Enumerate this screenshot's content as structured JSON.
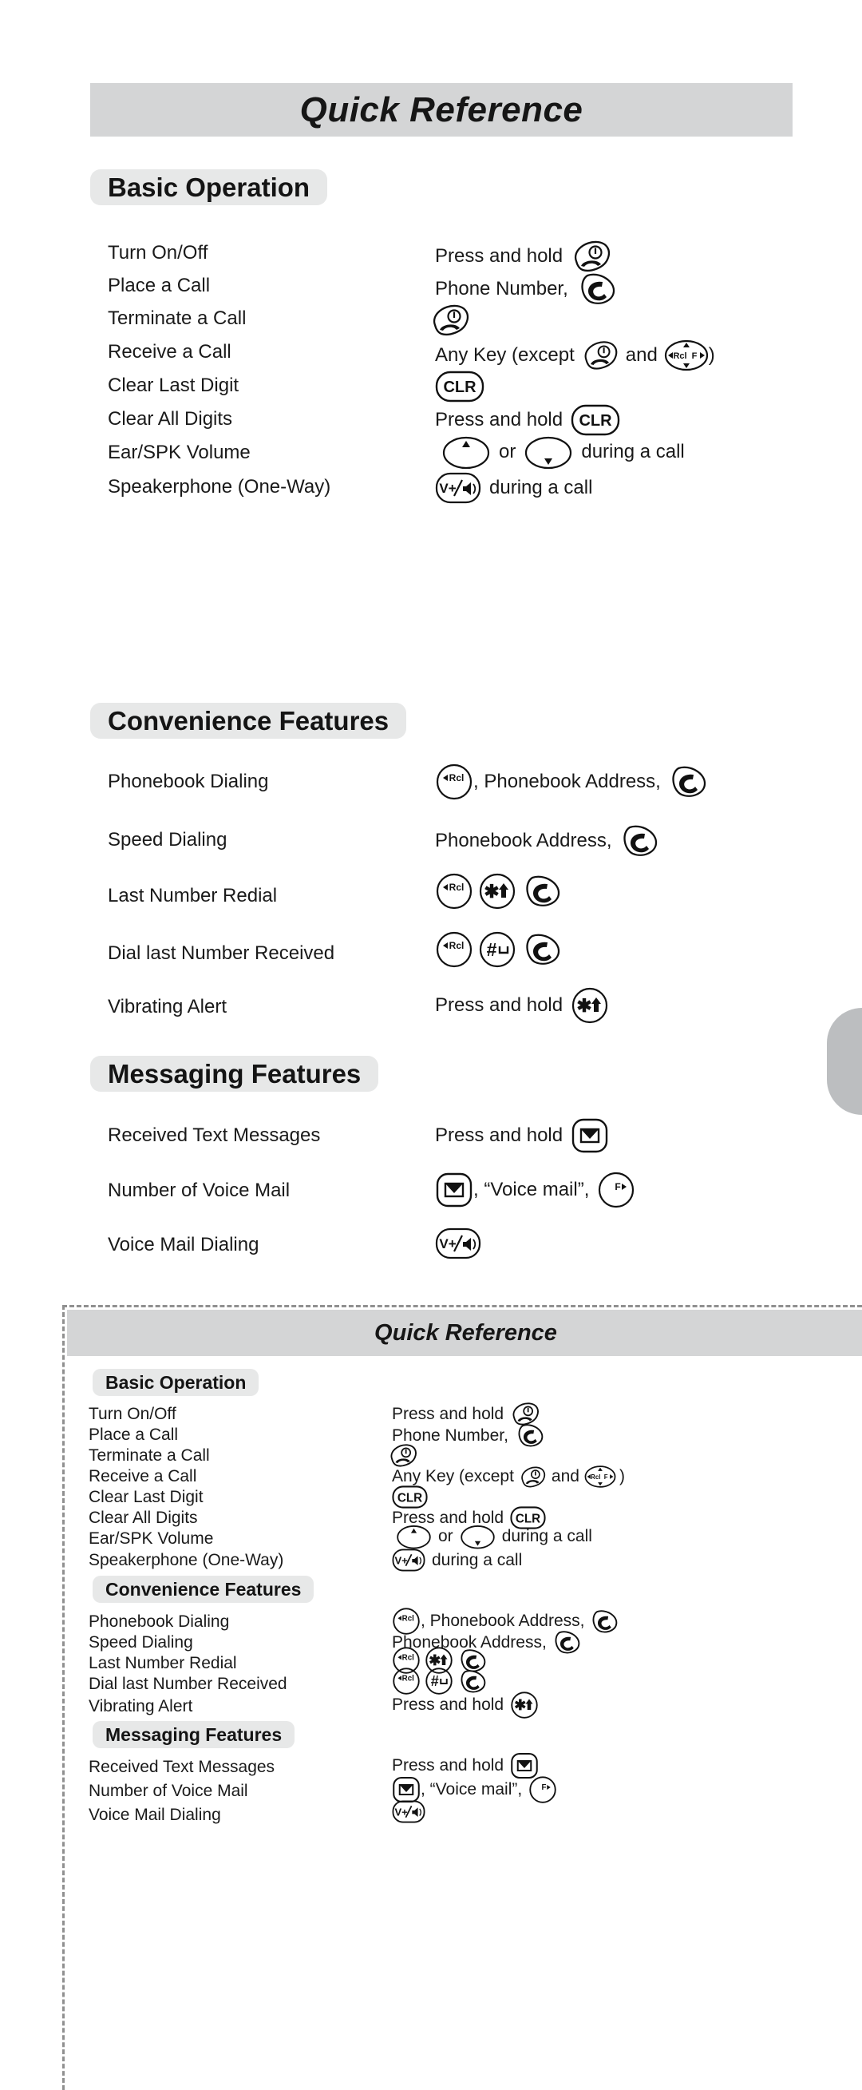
{
  "document": {
    "title": "Quick Reference"
  },
  "top_card": {
    "title": "Quick Reference",
    "sections": [
      {
        "heading": "Basic Operation",
        "rows": [
          {
            "label": "Turn On/Off",
            "value_text": "Press and hold",
            "keys": [
              "end-key"
            ]
          },
          {
            "label": "Place a Call",
            "value_text": "Phone Number,",
            "keys": [
              "send-key"
            ]
          },
          {
            "label": "Terminate a Call",
            "value_text": "",
            "keys": [
              "end-key"
            ]
          },
          {
            "label": "Receive a Call",
            "value_text": "Any Key (except",
            "keys": [
              "end-key",
              "nav-key"
            ]
          },
          {
            "label": "Clear Last Digit",
            "value_text": "",
            "keys": [
              "clr-key"
            ]
          },
          {
            "label": "Clear All Digits",
            "value_text": "Press and hold",
            "keys": [
              "clr-key"
            ]
          },
          {
            "label": "Ear/SPK Volume",
            "value_text": "",
            "keys": [
              "vol-up-key",
              "vol-down-key"
            ]
          },
          {
            "label": "Speakerphone (One-Way)",
            "value_text": "",
            "keys": [
              "spk-key"
            ]
          }
        ]
      },
      {
        "heading": "Convenience Features",
        "rows": [
          {
            "label": "Phonebook Dialing",
            "value_text": "",
            "keys": [
              "rcl-key",
              "send-key"
            ]
          },
          {
            "label": "Speed Dialing",
            "value_text": "Phonebook Address,",
            "keys": [
              "send-key"
            ]
          },
          {
            "label": "Last Number Redial",
            "value_text": "",
            "keys": [
              "rcl-key",
              "star-key",
              "send-key"
            ]
          },
          {
            "label": "Dial last Number Received",
            "value_text": "",
            "keys": [
              "rcl-key",
              "pound-key",
              "send-key"
            ]
          },
          {
            "label": "Vibrating Alert",
            "value_text": "Press and hold",
            "keys": [
              "star-key"
            ]
          }
        ]
      },
      {
        "heading": "Messaging Features",
        "rows": [
          {
            "label": "Received Text Messages",
            "value_text": "Press and hold",
            "keys": [
              "message-key"
            ]
          },
          {
            "label": "Number of Voice Mail",
            "value_text": "",
            "keys": [
              "message-key",
              "f-key"
            ]
          },
          {
            "label": "Voice Mail Dialing",
            "value_text": "",
            "keys": [
              "spk-key"
            ]
          }
        ]
      }
    ]
  },
  "bottom_card": {
    "title": "Quick Reference",
    "sections": [
      {
        "heading": "Basic Operation",
        "rows": [
          {
            "label": "Turn On/Off",
            "value_text": "Press and hold"
          },
          {
            "label": "Place a Call",
            "value_text": "Phone Number,"
          },
          {
            "label": "Terminate a Call",
            "value_text": ""
          },
          {
            "label": "Receive a Call",
            "value_text": "Any Key (except"
          },
          {
            "label": "Clear Last Digit",
            "value_text": ""
          },
          {
            "label": "Clear All Digits",
            "value_text": "Press and hold"
          },
          {
            "label": "Ear/SPK Volume",
            "value_text": ""
          },
          {
            "label": "Speakerphone (One-Way)",
            "value_text": ""
          }
        ]
      },
      {
        "heading": "Convenience Features",
        "rows": [
          {
            "label": "Phonebook Dialing",
            "value_text": ""
          },
          {
            "label": "Speed Dialing",
            "value_text": "Phonebook Address,"
          },
          {
            "label": "Last Number Redial",
            "value_text": ""
          },
          {
            "label": "Dial last Number Received",
            "value_text": ""
          },
          {
            "label": "Vibrating Alert",
            "value_text": "Press and hold"
          }
        ]
      },
      {
        "heading": "Messaging Features",
        "rows": [
          {
            "label": "Received Text Messages",
            "value_text": "Press and hold"
          },
          {
            "label": "Number of Voice Mail",
            "value_text": ""
          },
          {
            "label": "Voice Mail Dialing",
            "value_text": ""
          }
        ]
      }
    ]
  },
  "phrases": {
    "and": "and",
    "close_paren": ")",
    "comma": ",",
    "comma_phonebook_address": ", Phonebook Address,",
    "or": "or",
    "during_a_call": "during a call",
    "voice_mail_quoted": ", “Voice mail”,"
  },
  "key_labels": {
    "clr": "CLR",
    "rcl": "Rcl",
    "f": "F",
    "spk": "V+/",
    "nav_rcl": "Rcl",
    "nav_f": "F"
  },
  "colors": {
    "title_bar_bg": "#d4d5d6",
    "section_chip_bg": "#e7e8e8",
    "text": "#1a1a1a",
    "dashed_border": "#909090",
    "edge_tab": "#bcbec0"
  }
}
